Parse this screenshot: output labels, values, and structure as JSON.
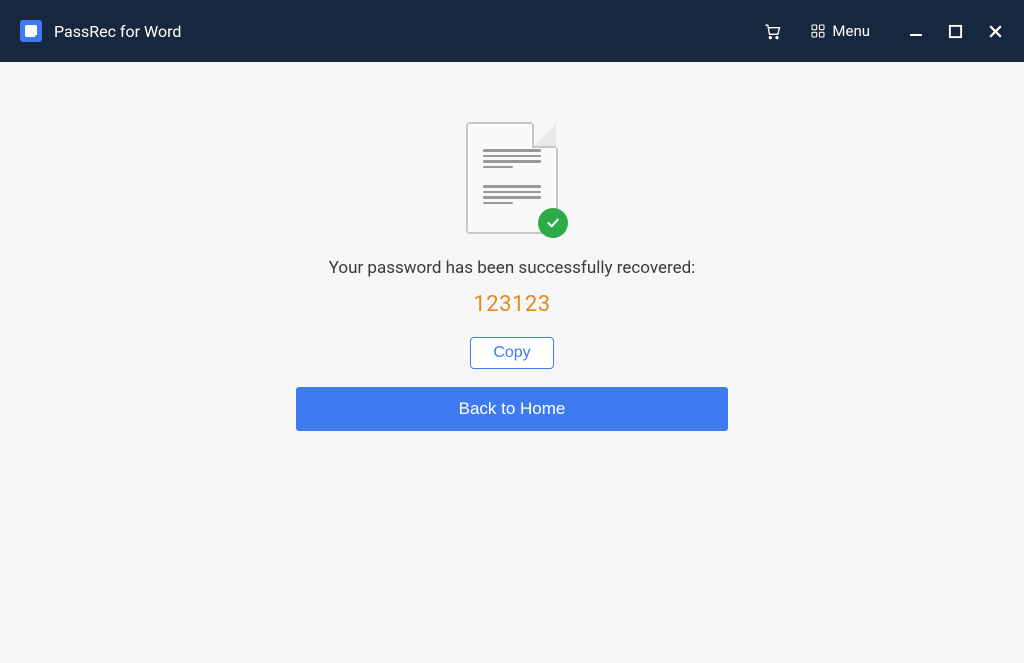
{
  "titlebar": {
    "app_title": "PassRec for Word",
    "menu_label": "Menu"
  },
  "result": {
    "message": "Your password has been successfully recovered:",
    "password": "123123",
    "copy_label": "Copy",
    "home_label": "Back to Home"
  }
}
